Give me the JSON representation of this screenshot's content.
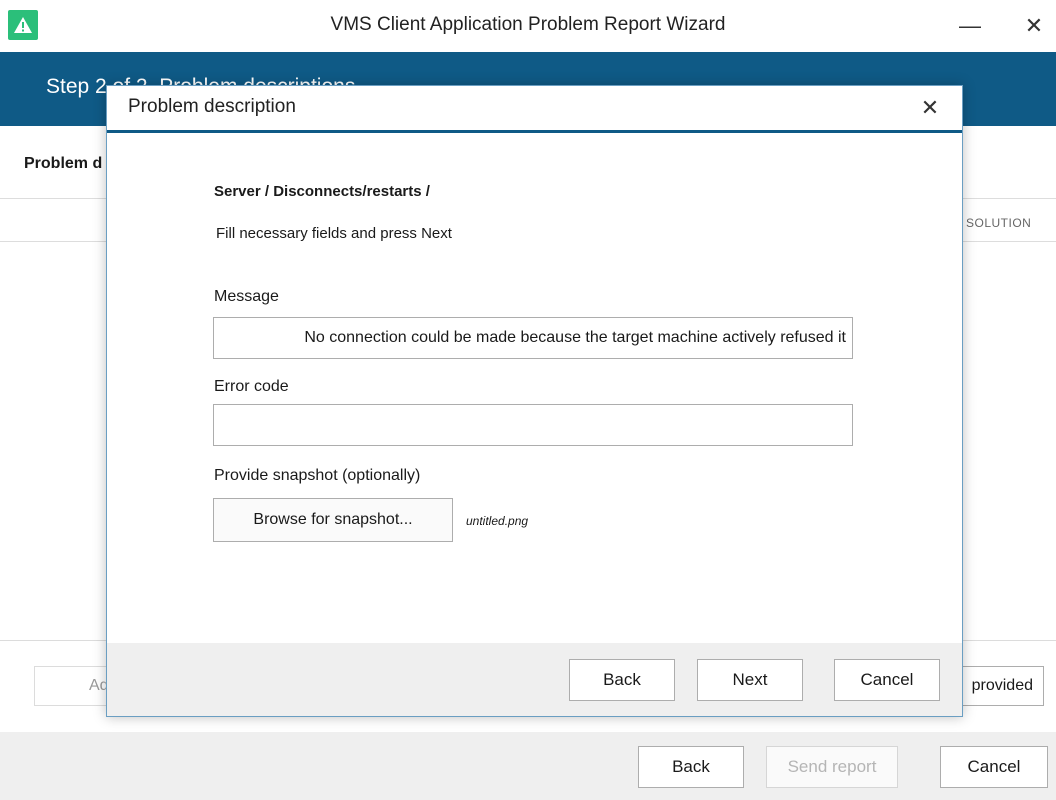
{
  "window": {
    "title": "VMS Client Application Problem Report Wizard",
    "minimize_glyph": "—",
    "close_glyph": "✕",
    "icon": "warning-triangle-icon",
    "icon_color": "#2bbf7a"
  },
  "step": {
    "text": "Step 2 of 2. Problem descriptions"
  },
  "background": {
    "problem_label": "Problem d",
    "solution_column_header": "SOLUTION",
    "add_button_label": "Ad",
    "provided_button_label": "provided"
  },
  "footer": {
    "back_label": "Back",
    "send_report_label": "Send report",
    "cancel_label": "Cancel"
  },
  "dialog": {
    "title": "Problem description",
    "close_glyph": "✕",
    "breadcrumb": "Server /  Disconnects/restarts /",
    "instruction": "Fill necessary fields and press Next",
    "message_label": "Message",
    "message_value": "No connection could be made because the target machine actively refused it",
    "error_code_label": "Error code",
    "error_code_value": "",
    "snapshot_label": "Provide snapshot (optionally)",
    "browse_button_label": "Browse for snapshot...",
    "snapshot_filename": "untitled.png",
    "back_label": "Back",
    "next_label": "Next",
    "cancel_label": "Cancel"
  },
  "colors": {
    "accent": "#0f5a86",
    "footer_bg": "#efefef"
  }
}
